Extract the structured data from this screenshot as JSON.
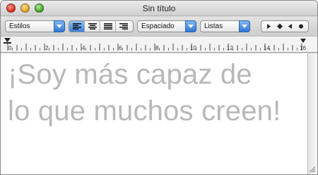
{
  "window": {
    "title": "Sin título"
  },
  "toolbar": {
    "styles_label": "Estilos",
    "spacing_label": "Espaciado",
    "lists_label": "Listas",
    "alignment": [
      "left",
      "center",
      "justify",
      "right"
    ],
    "alignment_selected": "left",
    "tabs_icons": [
      "right-tab-icon",
      "center-tab-icon",
      "left-tab-icon",
      "decimal-tab-icon"
    ]
  },
  "ruler": {
    "labels": [
      "0",
      "2",
      "4",
      "6",
      "8",
      "10",
      "12",
      "14",
      "16"
    ]
  },
  "document": {
    "lines": [
      "¡Soy más capaz de",
      "lo que muchos creen!"
    ],
    "text_color": "#b8b8b8"
  },
  "colors": {
    "accent": "#3a82de"
  }
}
